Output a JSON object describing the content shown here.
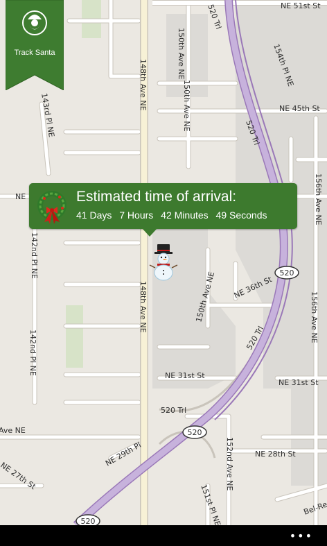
{
  "app": {
    "track_label": "Track Santa"
  },
  "eta": {
    "title": "Estimated time of arrival:",
    "days": "41 Days",
    "hours": "7 Hours",
    "minutes": "42 Minutes",
    "seconds": "49 Seconds"
  },
  "map": {
    "labels": {
      "ne_51st": "NE 51st St",
      "trl_520_top": "520 Trl",
      "ave150_top": "150th Ave NE",
      "pl154": "154th Pl NE",
      "ave148_top": "148th Ave NE",
      "ne_45th": "NE 45th St",
      "pl143": "143rd Pl NE",
      "trl_520_mid": "520 Trl",
      "ave150_mid": "150th Ave NE",
      "ave156_top": "156th Ave NE",
      "ne_left": "NE",
      "pl142_a": "142nd Pl NE",
      "pl142_b": "142nd Pl NE",
      "ne_36th": "NE 36th St",
      "ave150_low": "150th Ave NE",
      "ave148_low": "148th Ave NE",
      "trl_520_low": "520 Trl",
      "ave156_low": "156th Ave NE",
      "ne_31st_a": "NE 31st St",
      "ne_31st_b": "NE 31st St",
      "trl_520_bottom": "520 Trl",
      "ave_ne_left": "Ave NE",
      "ne_29th": "NE 29th Pl",
      "ne_28th": "NE 28th St",
      "ave152": "152nd Ave NE",
      "pl151": "151st Pl NE",
      "ne_27th": "NE 27th St",
      "bel_red": "Bel-Red"
    },
    "shields": [
      "520",
      "520",
      "520"
    ]
  },
  "colors": {
    "land": "#ebe8e2",
    "commercial": "#dcdad6",
    "park": "#d7e3c8",
    "road": "#ffffff",
    "road_outline": "#c9c4bb",
    "arterial": "#f7f1d6",
    "highway": "#b9a0cf",
    "highway_outline": "#9a78b8",
    "banner_green": "#3e7c30",
    "eta_green": "#3d7a2e"
  },
  "icons": [
    "santa-icon",
    "wreath-icon",
    "snowman-icon",
    "more-icon"
  ]
}
